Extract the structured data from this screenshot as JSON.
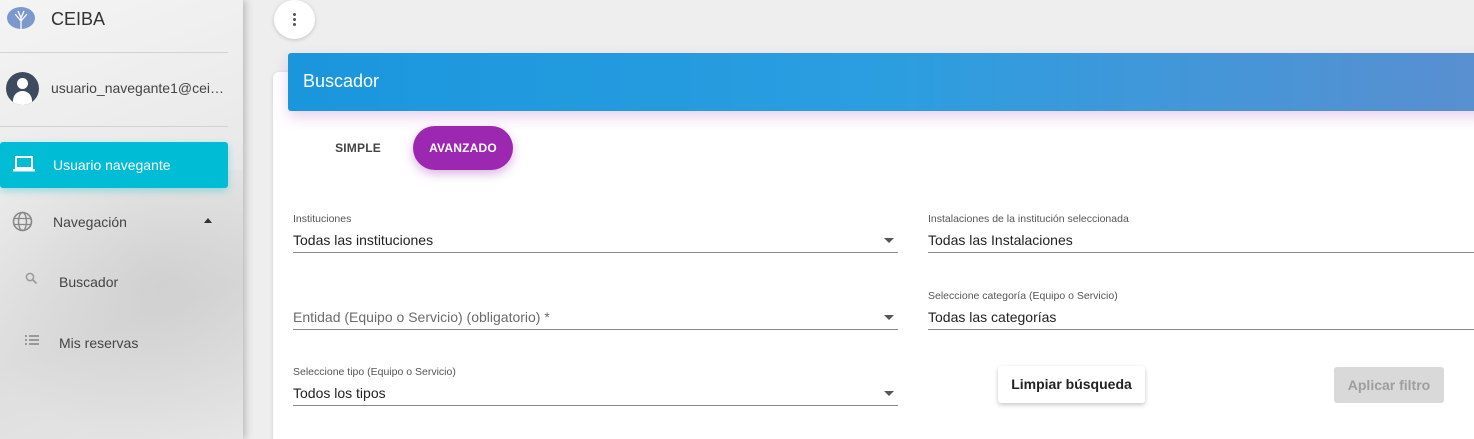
{
  "brand": {
    "name": "CEIBA",
    "logo_icon": "ceiba-tree-logo"
  },
  "user": {
    "email": "usuario_navegante1@ceiba...",
    "avatar_icon": "account-circle-icon"
  },
  "sidebar": {
    "active_item": {
      "label": "Usuario navegante",
      "icon": "laptop-icon"
    },
    "items": [
      {
        "label": "Navegación",
        "icon": "globe-icon",
        "expanded": true
      },
      {
        "label": "Buscador",
        "icon": "search-icon"
      },
      {
        "label": "Mis reservas",
        "icon": "list-icon"
      }
    ]
  },
  "header": {
    "menu_icon": "more-vert-icon"
  },
  "card": {
    "title": "Buscador"
  },
  "tabs": [
    {
      "label": "SIMPLE",
      "active": false
    },
    {
      "label": "AVANZADO",
      "active": true
    }
  ],
  "form": {
    "instituciones": {
      "label": "Instituciones",
      "value": "Todas las instituciones"
    },
    "instalaciones": {
      "label": "Instalaciones de la institución seleccionada",
      "value": "Todas las Instalaciones"
    },
    "entidad": {
      "placeholder": "Entidad (Equipo o Servicio) (obligatorio) *"
    },
    "categoria": {
      "label": "Seleccione categoría (Equipo o Servicio)",
      "value": "Todas las categorías"
    },
    "tipo": {
      "label": "Seleccione tipo (Equipo o Servicio)",
      "value": "Todos los tipos"
    }
  },
  "buttons": {
    "clear": "Limpiar búsqueda",
    "apply": "Aplicar filtro"
  },
  "colors": {
    "accent_cyan": "#00bcd4",
    "accent_purple": "#9c27b0",
    "header_blue": "#1a96dd"
  }
}
